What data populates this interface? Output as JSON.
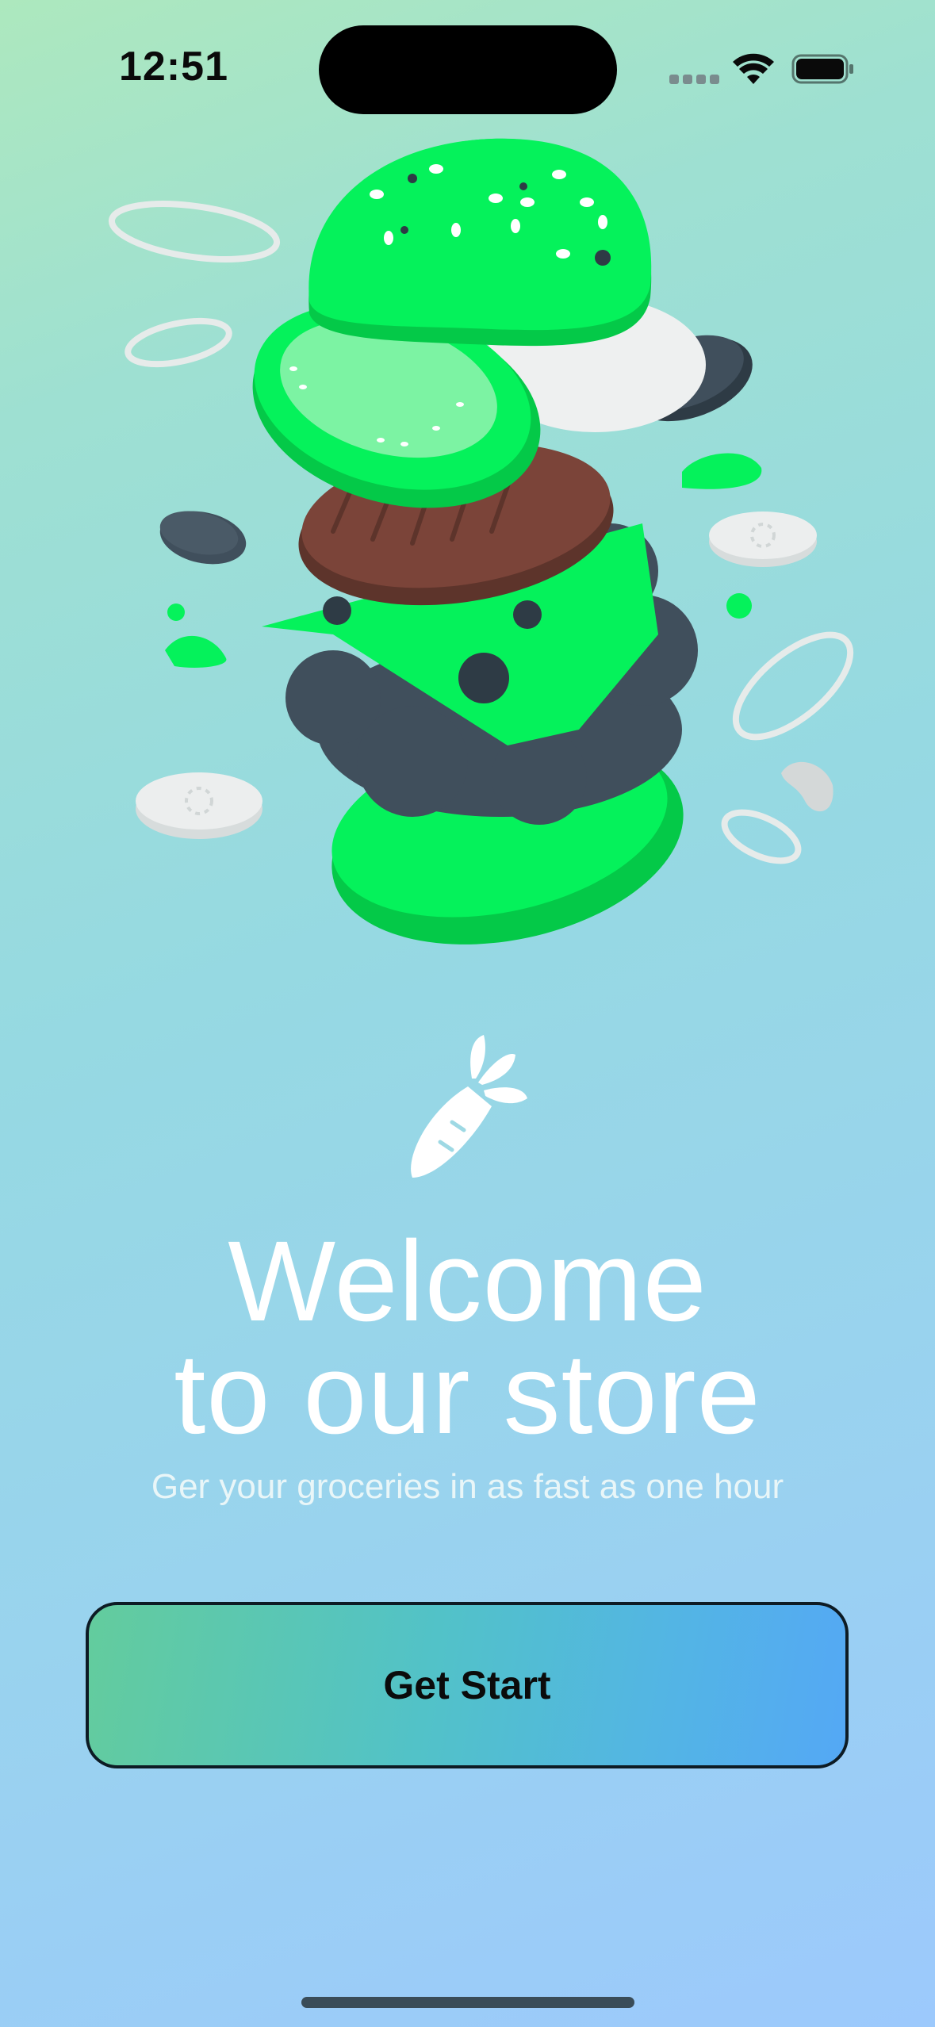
{
  "status_bar": {
    "time": "12:51"
  },
  "onboarding": {
    "title_line1": "Welcome",
    "title_line2": "to our store",
    "subtitle": "Ger your groceries in as fast as one hour",
    "cta_label": "Get Start"
  },
  "icons": {
    "hero": "burger-illustration",
    "logo": "carrot-icon",
    "wifi": "wifi-icon",
    "battery": "battery-icon",
    "signal": "signal-icon"
  },
  "colors": {
    "accent_green": "#05f25b",
    "patty_brown": "#7b4439",
    "dark_slate": "#404f5c",
    "cta_gradient_start": "#63cc9d",
    "cta_gradient_end": "#54a8f5"
  }
}
